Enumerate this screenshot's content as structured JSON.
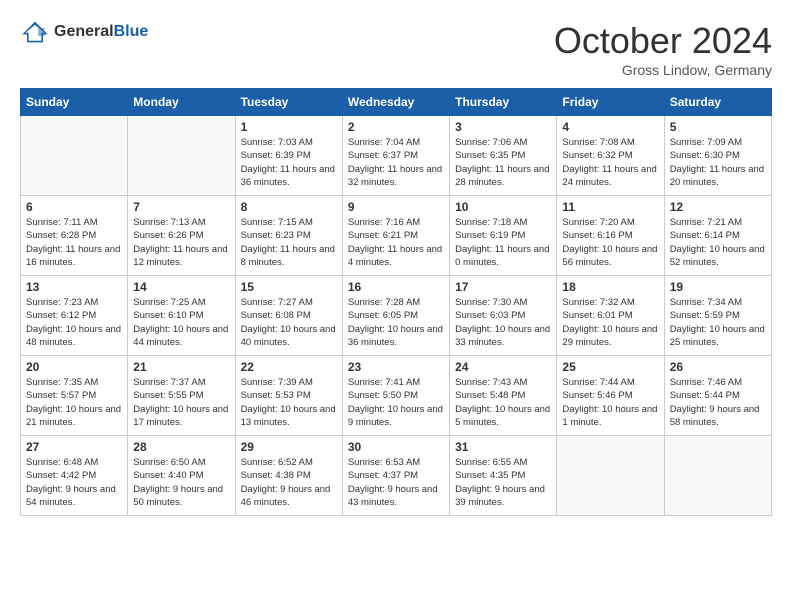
{
  "header": {
    "logo_line1": "General",
    "logo_line2": "Blue",
    "month_title": "October 2024",
    "location": "Gross Lindow, Germany"
  },
  "weekdays": [
    "Sunday",
    "Monday",
    "Tuesday",
    "Wednesday",
    "Thursday",
    "Friday",
    "Saturday"
  ],
  "weeks": [
    [
      {
        "day": "",
        "empty": true
      },
      {
        "day": "",
        "empty": true
      },
      {
        "day": "1",
        "sunrise": "Sunrise: 7:03 AM",
        "sunset": "Sunset: 6:39 PM",
        "daylight": "Daylight: 11 hours and 36 minutes."
      },
      {
        "day": "2",
        "sunrise": "Sunrise: 7:04 AM",
        "sunset": "Sunset: 6:37 PM",
        "daylight": "Daylight: 11 hours and 32 minutes."
      },
      {
        "day": "3",
        "sunrise": "Sunrise: 7:06 AM",
        "sunset": "Sunset: 6:35 PM",
        "daylight": "Daylight: 11 hours and 28 minutes."
      },
      {
        "day": "4",
        "sunrise": "Sunrise: 7:08 AM",
        "sunset": "Sunset: 6:32 PM",
        "daylight": "Daylight: 11 hours and 24 minutes."
      },
      {
        "day": "5",
        "sunrise": "Sunrise: 7:09 AM",
        "sunset": "Sunset: 6:30 PM",
        "daylight": "Daylight: 11 hours and 20 minutes."
      }
    ],
    [
      {
        "day": "6",
        "sunrise": "Sunrise: 7:11 AM",
        "sunset": "Sunset: 6:28 PM",
        "daylight": "Daylight: 11 hours and 16 minutes."
      },
      {
        "day": "7",
        "sunrise": "Sunrise: 7:13 AM",
        "sunset": "Sunset: 6:26 PM",
        "daylight": "Daylight: 11 hours and 12 minutes."
      },
      {
        "day": "8",
        "sunrise": "Sunrise: 7:15 AM",
        "sunset": "Sunset: 6:23 PM",
        "daylight": "Daylight: 11 hours and 8 minutes."
      },
      {
        "day": "9",
        "sunrise": "Sunrise: 7:16 AM",
        "sunset": "Sunset: 6:21 PM",
        "daylight": "Daylight: 11 hours and 4 minutes."
      },
      {
        "day": "10",
        "sunrise": "Sunrise: 7:18 AM",
        "sunset": "Sunset: 6:19 PM",
        "daylight": "Daylight: 11 hours and 0 minutes."
      },
      {
        "day": "11",
        "sunrise": "Sunrise: 7:20 AM",
        "sunset": "Sunset: 6:16 PM",
        "daylight": "Daylight: 10 hours and 56 minutes."
      },
      {
        "day": "12",
        "sunrise": "Sunrise: 7:21 AM",
        "sunset": "Sunset: 6:14 PM",
        "daylight": "Daylight: 10 hours and 52 minutes."
      }
    ],
    [
      {
        "day": "13",
        "sunrise": "Sunrise: 7:23 AM",
        "sunset": "Sunset: 6:12 PM",
        "daylight": "Daylight: 10 hours and 48 minutes."
      },
      {
        "day": "14",
        "sunrise": "Sunrise: 7:25 AM",
        "sunset": "Sunset: 6:10 PM",
        "daylight": "Daylight: 10 hours and 44 minutes."
      },
      {
        "day": "15",
        "sunrise": "Sunrise: 7:27 AM",
        "sunset": "Sunset: 6:08 PM",
        "daylight": "Daylight: 10 hours and 40 minutes."
      },
      {
        "day": "16",
        "sunrise": "Sunrise: 7:28 AM",
        "sunset": "Sunset: 6:05 PM",
        "daylight": "Daylight: 10 hours and 36 minutes."
      },
      {
        "day": "17",
        "sunrise": "Sunrise: 7:30 AM",
        "sunset": "Sunset: 6:03 PM",
        "daylight": "Daylight: 10 hours and 33 minutes."
      },
      {
        "day": "18",
        "sunrise": "Sunrise: 7:32 AM",
        "sunset": "Sunset: 6:01 PM",
        "daylight": "Daylight: 10 hours and 29 minutes."
      },
      {
        "day": "19",
        "sunrise": "Sunrise: 7:34 AM",
        "sunset": "Sunset: 5:59 PM",
        "daylight": "Daylight: 10 hours and 25 minutes."
      }
    ],
    [
      {
        "day": "20",
        "sunrise": "Sunrise: 7:35 AM",
        "sunset": "Sunset: 5:57 PM",
        "daylight": "Daylight: 10 hours and 21 minutes."
      },
      {
        "day": "21",
        "sunrise": "Sunrise: 7:37 AM",
        "sunset": "Sunset: 5:55 PM",
        "daylight": "Daylight: 10 hours and 17 minutes."
      },
      {
        "day": "22",
        "sunrise": "Sunrise: 7:39 AM",
        "sunset": "Sunset: 5:53 PM",
        "daylight": "Daylight: 10 hours and 13 minutes."
      },
      {
        "day": "23",
        "sunrise": "Sunrise: 7:41 AM",
        "sunset": "Sunset: 5:50 PM",
        "daylight": "Daylight: 10 hours and 9 minutes."
      },
      {
        "day": "24",
        "sunrise": "Sunrise: 7:43 AM",
        "sunset": "Sunset: 5:48 PM",
        "daylight": "Daylight: 10 hours and 5 minutes."
      },
      {
        "day": "25",
        "sunrise": "Sunrise: 7:44 AM",
        "sunset": "Sunset: 5:46 PM",
        "daylight": "Daylight: 10 hours and 1 minute."
      },
      {
        "day": "26",
        "sunrise": "Sunrise: 7:46 AM",
        "sunset": "Sunset: 5:44 PM",
        "daylight": "Daylight: 9 hours and 58 minutes."
      }
    ],
    [
      {
        "day": "27",
        "sunrise": "Sunrise: 6:48 AM",
        "sunset": "Sunset: 4:42 PM",
        "daylight": "Daylight: 9 hours and 54 minutes."
      },
      {
        "day": "28",
        "sunrise": "Sunrise: 6:50 AM",
        "sunset": "Sunset: 4:40 PM",
        "daylight": "Daylight: 9 hours and 50 minutes."
      },
      {
        "day": "29",
        "sunrise": "Sunrise: 6:52 AM",
        "sunset": "Sunset: 4:38 PM",
        "daylight": "Daylight: 9 hours and 46 minutes."
      },
      {
        "day": "30",
        "sunrise": "Sunrise: 6:53 AM",
        "sunset": "Sunset: 4:37 PM",
        "daylight": "Daylight: 9 hours and 43 minutes."
      },
      {
        "day": "31",
        "sunrise": "Sunrise: 6:55 AM",
        "sunset": "Sunset: 4:35 PM",
        "daylight": "Daylight: 9 hours and 39 minutes."
      },
      {
        "day": "",
        "empty": true
      },
      {
        "day": "",
        "empty": true
      }
    ]
  ]
}
